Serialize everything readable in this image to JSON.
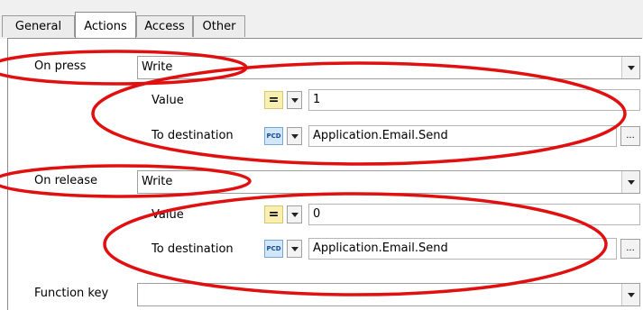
{
  "tabs": [
    "General",
    "Actions",
    "Access",
    "Other"
  ],
  "active_tab": "Actions",
  "on_press": {
    "label": "On press",
    "action": "Write",
    "value_label": "Value",
    "operator": "=",
    "value": "1",
    "dest_label": "To destination",
    "dest_icon": "PCD",
    "destination": "Application.Email.Send",
    "browse": "..."
  },
  "on_release": {
    "label": "On release",
    "action": "Write",
    "value_label": "Value",
    "operator": "=",
    "value": "0",
    "dest_label": "To destination",
    "dest_icon": "PCD",
    "destination": "Application.Email.Send",
    "browse": "..."
  },
  "function_key": {
    "label": "Function key",
    "value": ""
  },
  "colors": {
    "annotation": "#e01010",
    "operator_bg": "#f9efb0",
    "pcd_bg": "#cfe6fb"
  }
}
